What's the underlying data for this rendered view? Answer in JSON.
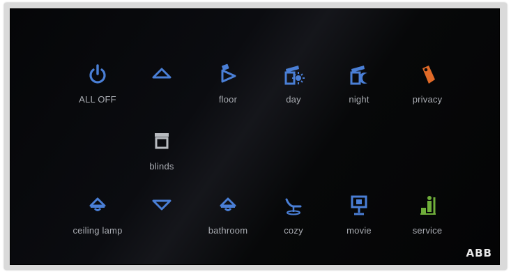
{
  "panel": {
    "buttons": [
      {
        "id": "all-off",
        "label": "ALL OFF",
        "icon": "power-icon",
        "color": "#4a7fd6"
      },
      {
        "id": "blinds-up",
        "label": "",
        "icon": "triangle-up-icon",
        "color": "#4a7fd6"
      },
      {
        "id": "floor",
        "label": "floor",
        "icon": "floor-lamp-icon",
        "color": "#4a7fd6"
      },
      {
        "id": "day",
        "label": "day",
        "icon": "day-scene-icon",
        "color": "#4a7fd6"
      },
      {
        "id": "night",
        "label": "night",
        "icon": "night-scene-icon",
        "color": "#4a7fd6"
      },
      {
        "id": "privacy",
        "label": "privacy",
        "icon": "privacy-tag-icon",
        "color": "#e06a28"
      },
      {
        "id": "blinds",
        "label": "blinds",
        "icon": "blinds-icon",
        "color": "#b8bbc0"
      },
      {
        "id": "ceiling-lamp",
        "label": "ceiling lamp",
        "icon": "ceiling-lamp-icon",
        "color": "#4a7fd6"
      },
      {
        "id": "blinds-down",
        "label": "",
        "icon": "triangle-down-icon",
        "color": "#4a7fd6"
      },
      {
        "id": "bathroom",
        "label": "bathroom",
        "icon": "bathroom-lamp-icon",
        "color": "#4a7fd6"
      },
      {
        "id": "cozy",
        "label": "cozy",
        "icon": "lounge-chair-icon",
        "color": "#4a7fd6"
      },
      {
        "id": "movie",
        "label": "movie",
        "icon": "movie-screen-icon",
        "color": "#4a7fd6"
      },
      {
        "id": "service",
        "label": "service",
        "icon": "cleaning-service-icon",
        "color": "#6fae3a"
      }
    ]
  },
  "brand": {
    "logo_text": "ABB"
  }
}
